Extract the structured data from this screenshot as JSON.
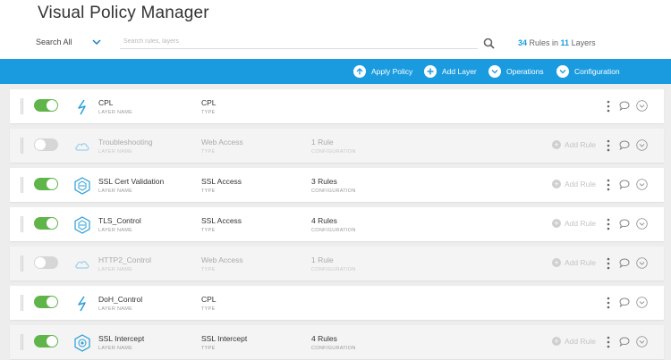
{
  "header": {
    "title": "Visual Policy Manager",
    "search_scope": "Search All",
    "search_placeholder": "Search rules, layers",
    "rules_count": "34",
    "rules_label": " Rules in ",
    "layers_count": "11",
    "layers_label": " Layers"
  },
  "toolbar": {
    "apply_policy": "Apply Policy",
    "add_layer": "Add Layer",
    "operations": "Operations",
    "configuration": "Configuration"
  },
  "labels": {
    "layer_name": "LAYER NAME",
    "type": "TYPE",
    "configuration": "CONFIGURATION",
    "add_rule": "Add Rule"
  },
  "colors": {
    "accent": "#1a9be0",
    "toggle_on": "#5fb549",
    "toggle_off": "#d6d6d6"
  },
  "layers": [
    {
      "name": "CPL",
      "type": "CPL",
      "config": "",
      "enabled": true,
      "icon": "cpl-bolt-icon",
      "add_rule": false
    },
    {
      "name": "Troubleshooting",
      "type": "Web Access",
      "config": "1 Rule",
      "enabled": false,
      "icon": "cloud-icon",
      "add_rule": true
    },
    {
      "name": "SSL Cert Validation",
      "type": "SSL Access",
      "config": "3 Rules",
      "enabled": true,
      "icon": "shield-hexagon-icon",
      "add_rule": true
    },
    {
      "name": "TLS_Control",
      "type": "SSL Access",
      "config": "4 Rules",
      "enabled": true,
      "icon": "shield-hexagon-icon",
      "add_rule": true
    },
    {
      "name": "HTTP2_Control",
      "type": "Web Access",
      "config": "1 Rule",
      "enabled": false,
      "icon": "cloud-icon",
      "add_rule": true
    },
    {
      "name": "DoH_Control",
      "type": "CPL",
      "config": "",
      "enabled": true,
      "icon": "cpl-bolt-icon",
      "add_rule": false
    },
    {
      "name": "SSL Intercept",
      "type": "SSL Intercept",
      "config": "4 Rules",
      "enabled": true,
      "icon": "intercept-hexagon-icon",
      "add_rule": true
    }
  ]
}
